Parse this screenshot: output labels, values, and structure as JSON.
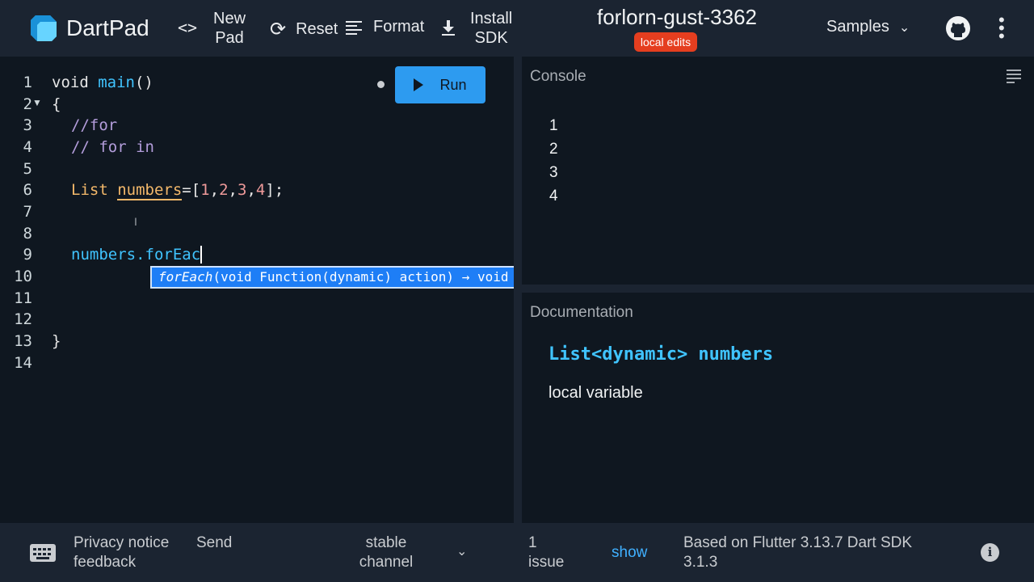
{
  "header": {
    "app_name": "DartPad",
    "code_icon": "code-icon",
    "new_pad_line1": "New",
    "new_pad_line2": "Pad",
    "reset_label": "Reset",
    "format_label": "Format",
    "install_line1": "Install",
    "install_line2": "SDK",
    "pad_title": "forlorn-gust-3362",
    "local_edits_badge": "local edits",
    "samples_label": "Samples"
  },
  "colors": {
    "accent": "#2d9bf0",
    "badge": "#e53e1f",
    "doc_signature": "#40c4ff",
    "link": "#40b0ff",
    "keyword": "#f3b86a",
    "comment": "#b39ddb",
    "number": "#ef9a9a"
  },
  "editor": {
    "run_label": "Run",
    "line_numbers": [
      "1",
      "2",
      "3",
      "4",
      "5",
      "6",
      "7",
      "8",
      "9",
      "10",
      "11",
      "12",
      "13",
      "14"
    ],
    "lines": {
      "l1_void": "void ",
      "l1_main": "main",
      "l1_parens": "()",
      "l2": "{",
      "l3": "//for",
      "l4": "// for in",
      "l6_type": "List ",
      "l6_var": "numbers",
      "l6_eq": "=[",
      "l6_n1": "1",
      "l6_c1": ",",
      "l6_n2": "2",
      "l6_c2": ",",
      "l6_n3": "3",
      "l6_c3": ",",
      "l6_n4": "4",
      "l6_end": "];",
      "l9": "numbers.forEac",
      "l13": "}"
    },
    "autocomplete": {
      "match": "forEach",
      "rest": "(void Function(dynamic) action) → void"
    }
  },
  "console": {
    "title": "Console",
    "output": [
      "1",
      "2",
      "3",
      "4"
    ]
  },
  "documentation": {
    "title": "Documentation",
    "signature": "List<dynamic> numbers",
    "description": "local variable"
  },
  "footer": {
    "privacy_line1": "Privacy notice",
    "privacy_line2": "feedback",
    "send": "Send",
    "channel_line1": "stable",
    "channel_line2": "channel",
    "issue_count": "1",
    "issue_label": "issue",
    "show": "show",
    "version_line1": "Based on Flutter 3.13.7 Dart SDK",
    "version_line2": "3.1.3"
  }
}
